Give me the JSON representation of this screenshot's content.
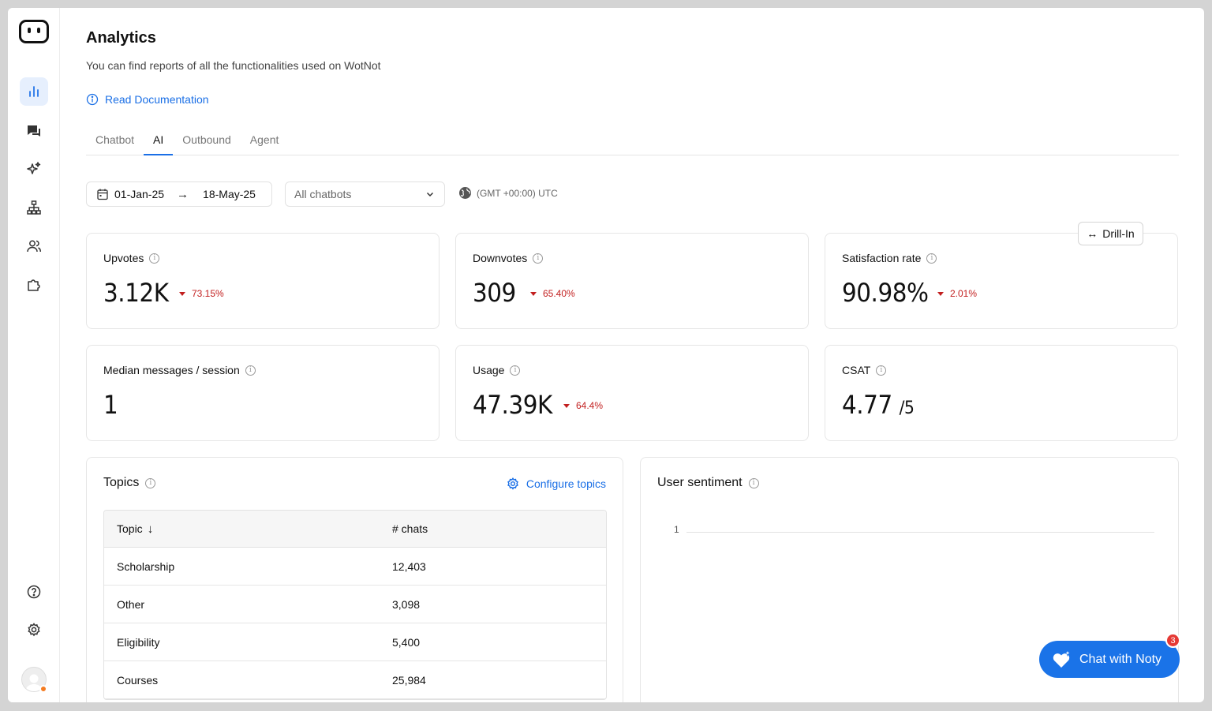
{
  "header": {
    "title": "Analytics",
    "subtitle": "You can find reports of all the functionalities used on WotNot",
    "doc_link": "Read Documentation"
  },
  "tabs": [
    {
      "label": "Chatbot",
      "active": false
    },
    {
      "label": "AI",
      "active": true
    },
    {
      "label": "Outbound",
      "active": false
    },
    {
      "label": "Agent",
      "active": false
    }
  ],
  "filters": {
    "date_start": "01-Jan-25",
    "date_end": "18-May-25",
    "chatbot_select": "All chatbots",
    "timezone": "(GMT +00:00) UTC"
  },
  "drill_in": "Drill-In",
  "metrics": [
    {
      "label": "Upvotes",
      "value": "3.12K",
      "change": "73.15%"
    },
    {
      "label": "Downvotes",
      "value": "309",
      "change": "65.40%"
    },
    {
      "label": "Satisfaction rate",
      "value": "90.98%",
      "change": "2.01%"
    },
    {
      "label": "Median messages / session",
      "value": "1"
    },
    {
      "label": "Usage",
      "value": "47.39K",
      "change": "64.4%"
    },
    {
      "label": "CSAT",
      "value": "4.77",
      "suffix": "/5"
    }
  ],
  "topics": {
    "title": "Topics",
    "configure": "Configure topics",
    "col_topic": "Topic",
    "col_chats": "# chats",
    "rows": [
      {
        "topic": "Scholarship",
        "chats": "12,403"
      },
      {
        "topic": "Other",
        "chats": "3,098"
      },
      {
        "topic": "Eligibility",
        "chats": "5,400"
      },
      {
        "topic": "Courses",
        "chats": "25,984"
      }
    ]
  },
  "sentiment": {
    "title": "User sentiment",
    "y_tick": "1"
  },
  "chat": {
    "label": "Chat with Noty",
    "badge": "3"
  },
  "colors": {
    "accent": "#1a73e8",
    "link": "#1a6fe6",
    "negative": "#c21f1f",
    "active_nav_bg": "#e6effd"
  },
  "icons": {
    "nav": [
      "bar-chart-icon",
      "chat-icon",
      "sparkles-icon",
      "hierarchy-icon",
      "users-icon",
      "puzzle-icon"
    ],
    "bottom": [
      "help-icon",
      "settings-icon"
    ]
  }
}
